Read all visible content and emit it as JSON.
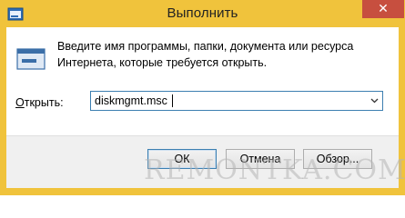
{
  "window": {
    "title": "Выполнить",
    "close_symbol": "✕",
    "app_icon": "run-app-icon"
  },
  "dialog": {
    "icon": "run-dialog-icon",
    "description_line1": "Введите имя программы, папки, документа или ресурса",
    "description_line2": "Интернета, которые требуется открыть.",
    "open_label_accel": "О",
    "open_label_rest": "ткрыть:",
    "open_value": "diskmgmt.msc"
  },
  "buttons": {
    "ok": "ОК",
    "cancel": "Отмена",
    "browse": "Обзор..."
  },
  "watermark": "REMONTKA.COM",
  "colors": {
    "frame": "#f0c33c",
    "close_button": "#c74f3f",
    "focus_border": "#3c7fb1",
    "footer": "#f0f0f0"
  }
}
